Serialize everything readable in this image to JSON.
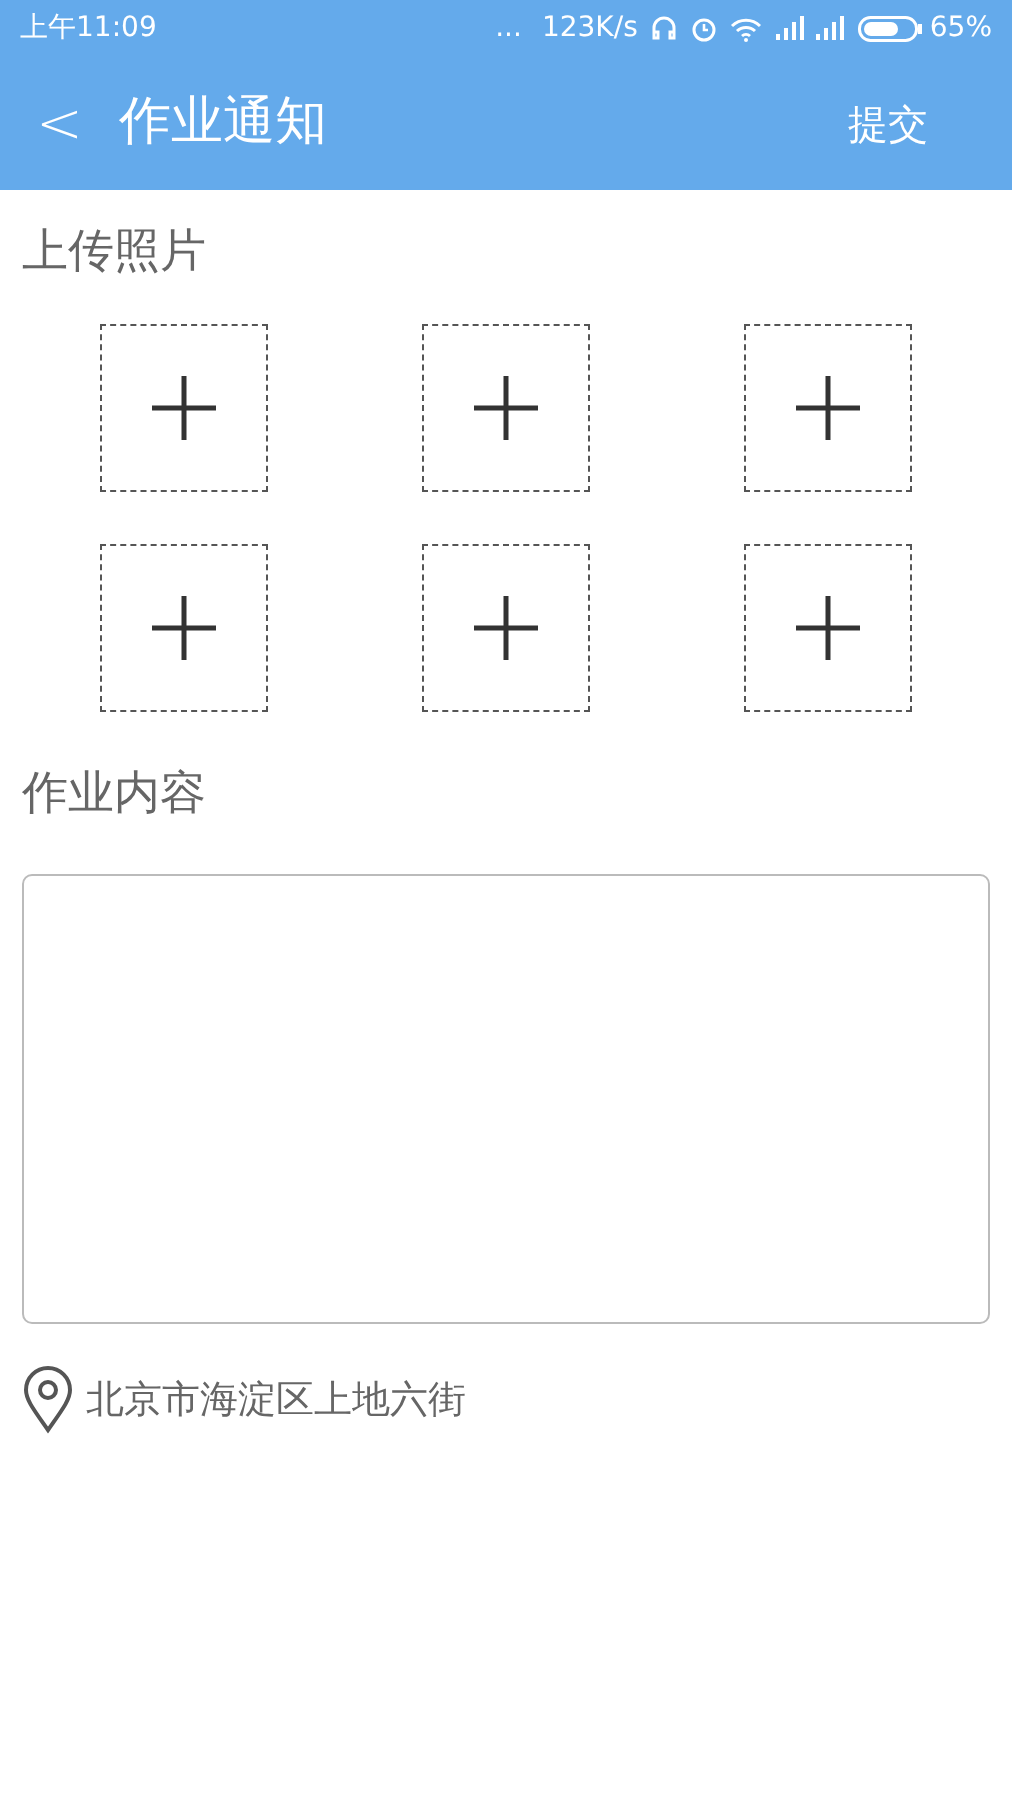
{
  "status_bar": {
    "time": "上午11:09",
    "dots": "...",
    "network_speed": "123K/s",
    "battery_percent": "65%"
  },
  "header": {
    "back": "<",
    "title": "作业通知",
    "action": "提交"
  },
  "photos": {
    "label": "上传照片",
    "slots": [
      {
        "kind": "add"
      },
      {
        "kind": "add"
      },
      {
        "kind": "add"
      },
      {
        "kind": "add"
      },
      {
        "kind": "add"
      },
      {
        "kind": "add"
      }
    ]
  },
  "content": {
    "label": "作业内容"
  },
  "location": {
    "address": "北京市海淀区上地六街"
  }
}
